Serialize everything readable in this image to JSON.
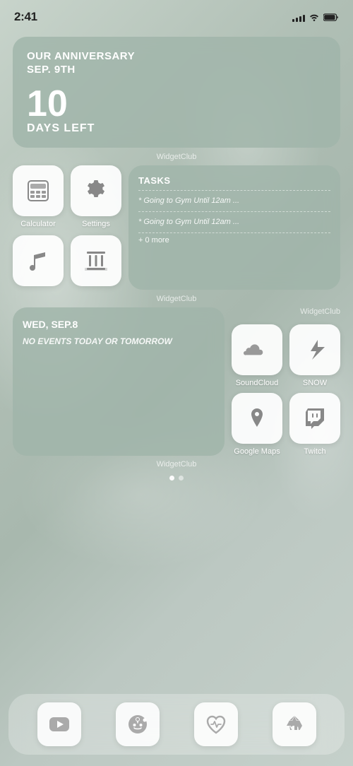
{
  "status": {
    "time": "2:41",
    "signal_bars": [
      4,
      6,
      8,
      10,
      12
    ],
    "wifi": "wifi",
    "battery": "battery"
  },
  "anniversary_widget": {
    "title": "Our anniversary",
    "date": "Sep. 9th",
    "days_number": "10",
    "days_label": "Days Left",
    "widget_source": "WidgetClub"
  },
  "app_icons": [
    {
      "id": "calculator",
      "label": "Calculator"
    },
    {
      "id": "settings",
      "label": "Settings"
    },
    {
      "id": "music",
      "label": ""
    },
    {
      "id": "library",
      "label": ""
    }
  ],
  "tasks_widget": {
    "title": "Tasks",
    "items": [
      "* Going to Gym Until 12am ...",
      "* Going to Gym Until 12am ..."
    ],
    "more": "+ 0 more",
    "widget_source": "WidgetClub"
  },
  "calendar_widget": {
    "day": "Wed, Sep.8",
    "note": "No events today or tomorrow",
    "widget_source": "WidgetClub"
  },
  "right_apps": [
    {
      "id": "soundcloud",
      "label": "SoundCloud"
    },
    {
      "id": "snow",
      "label": "SNOW"
    },
    {
      "id": "google-maps",
      "label": "Google Maps"
    },
    {
      "id": "twitch",
      "label": "Twitch"
    }
  ],
  "dock_apps": [
    {
      "id": "youtube",
      "label": "YouTube"
    },
    {
      "id": "reddit",
      "label": "Reddit"
    },
    {
      "id": "health",
      "label": "Health"
    },
    {
      "id": "appstore",
      "label": "App Store"
    }
  ],
  "page_dots": [
    true,
    false
  ]
}
